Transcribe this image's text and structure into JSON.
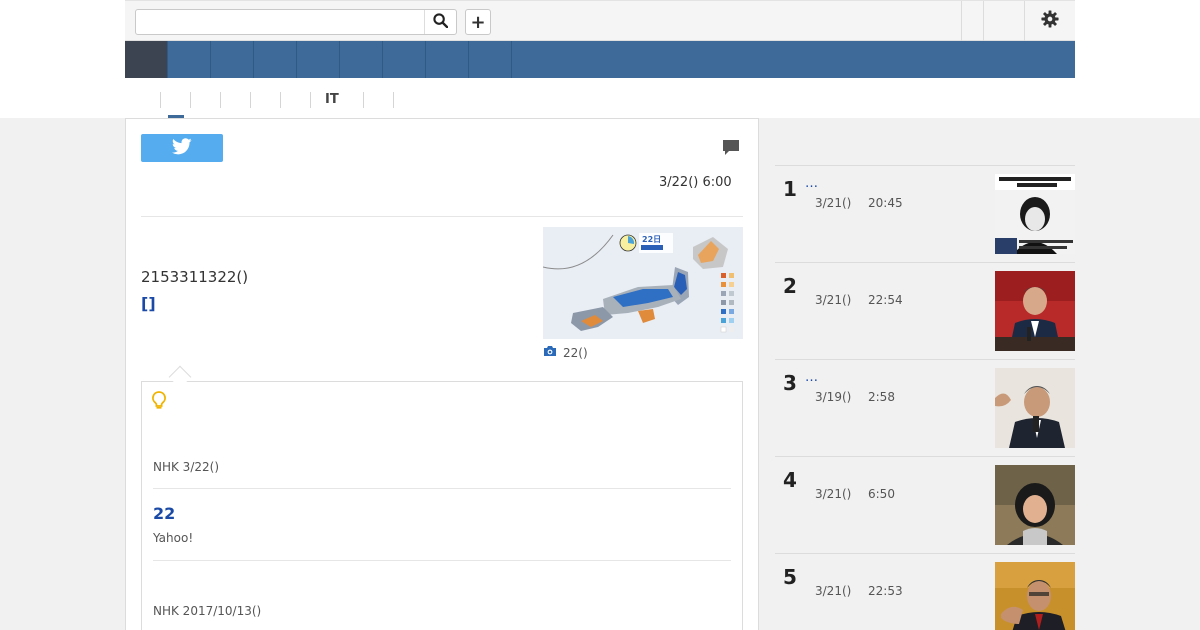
{
  "header": {
    "search": {
      "placeholder": "",
      "value": ""
    },
    "search_icon": "search-icon",
    "add_label": "+",
    "settings_icon": "gear-icon"
  },
  "nav": {
    "items_count": 9,
    "active_index": 0
  },
  "subtabs": [
    "",
    "",
    "",
    "",
    "",
    "IT",
    "",
    ""
  ],
  "article": {
    "share_icon": "twitter-icon",
    "comment_icon": "comment-icon",
    "date": "3/22() 6:00",
    "body": "2153311322()",
    "body_link": "[]",
    "image_caption": "22()",
    "image_date_label": "22日",
    "related": {
      "source1": "NHK 3/22()",
      "title": "22",
      "subtitle": "Yahoo!",
      "source2": "NHK 2017/10/13()"
    }
  },
  "sidebar": {
    "ranking": [
      {
        "rank": "1",
        "title": "…",
        "date": "3/21()",
        "time": "20:45"
      },
      {
        "rank": "2",
        "title": "",
        "date": "3/21()",
        "time": "22:54"
      },
      {
        "rank": "3",
        "title": "…",
        "date": "3/19()",
        "time": "2:58"
      },
      {
        "rank": "4",
        "title": "",
        "date": "3/21()",
        "time": "6:50"
      },
      {
        "rank": "5",
        "title": "",
        "date": "3/21()",
        "time": "22:53"
      }
    ]
  },
  "colors": {
    "nav": "#3d6a99",
    "nav_active": "#3b4450",
    "link": "#1a4aa6",
    "twitter": "#55acee"
  }
}
